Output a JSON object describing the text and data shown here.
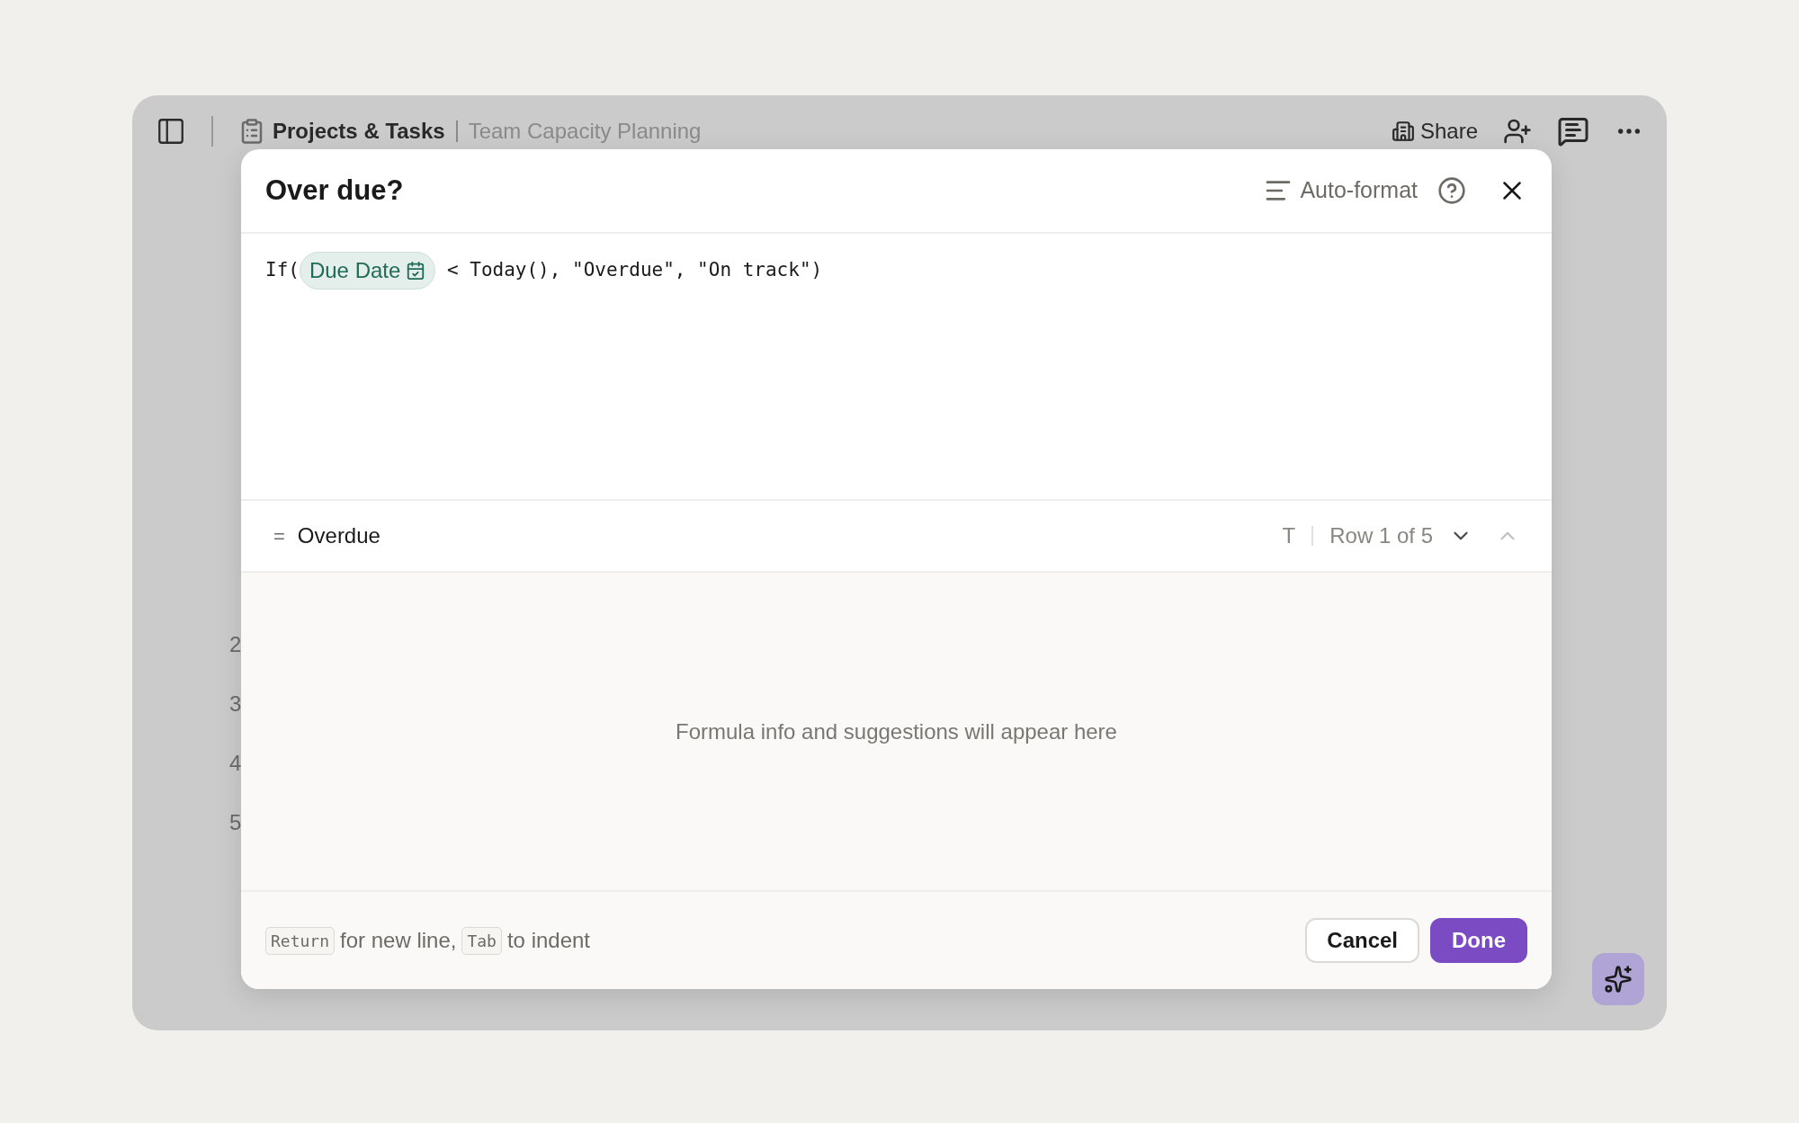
{
  "app_bar": {
    "breadcrumb": "Projects & Tasks",
    "page_title": "Team Capacity Planning",
    "share": "Share"
  },
  "row_numbers": [
    "2",
    "3",
    "4",
    "5"
  ],
  "dialog": {
    "title": "Over due?",
    "auto_format": "Auto-format",
    "formula": [
      {
        "kind": "code",
        "text": "If("
      },
      {
        "kind": "field",
        "text": "Due Date"
      },
      {
        "kind": "code",
        "text": " < Today(), \"Overdue\", \"On track\")"
      }
    ],
    "result": {
      "prefix": "=",
      "value": "Overdue",
      "type_label": "T",
      "row_position": "Row 1 of 5"
    },
    "info": "Formula info and suggestions will appear here",
    "hint": [
      {
        "kind": "key",
        "text": "Return"
      },
      {
        "kind": "text",
        "text": "for new line,"
      },
      {
        "kind": "key",
        "text": "Tab"
      },
      {
        "kind": "text",
        "text": "to indent"
      }
    ],
    "buttons": [
      {
        "label": "Cancel",
        "kind": "secondary"
      },
      {
        "label": "Done",
        "kind": "primary"
      }
    ]
  }
}
